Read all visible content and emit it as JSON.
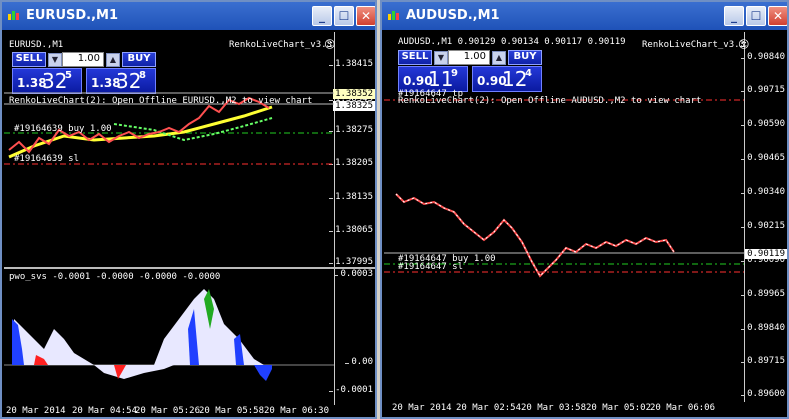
{
  "colors": {
    "titlebar": "#2a5fc8",
    "chart_bg": "#000000",
    "ma_fast": "#ffff33",
    "ma_slow": "#66ff66",
    "tp": "#ff3030",
    "sl": "#ff3030",
    "buyline": "#22cc22"
  },
  "left": {
    "title": "EURUSD.,M1",
    "chart_label": "EURUSD.,M1",
    "indicator_name": "RenkoLiveChart_v3.3",
    "sell_label": "SELL",
    "buy_label": "BUY",
    "lot": "1.00",
    "sell_base": "1.38",
    "sell_big": "32",
    "sell_sup": "5",
    "buy_base": "1.38",
    "buy_big": "32",
    "buy_sup": "8",
    "notice": "RenkoLiveChart(2): Open Offline EURUSD.,M2 to view chart",
    "buy_line": "#19164639 buy 1.00",
    "sl_line": "#19164639 sl",
    "price_ticks": [
      "1.38415",
      "1.38345",
      "1.38275",
      "1.38205",
      "1.38135",
      "1.38065",
      "1.37995"
    ],
    "price_mark_top": "1.38352",
    "price_mark_bottom": "1.38325",
    "osc_label": "pwo_svs -0.0001 -0.0000 -0.0000 -0.0000",
    "osc_ticks": [
      "0.0003",
      "0.00",
      "-0.0001"
    ],
    "time_ticks": [
      "20 Mar 2014",
      "20 Mar 04:54",
      "20 Mar 05:26",
      "20 Mar 05:58",
      "20 Mar 06:30"
    ]
  },
  "right": {
    "title": "AUDUSD.,M1",
    "chart_label": "AUDUSD.,M1  0.90129 0.90134 0.90117 0.90119",
    "indicator_name": "RenkoLiveChart_v3.3",
    "sell_label": "SELL",
    "buy_label": "BUY",
    "lot": "1.00",
    "sell_base": "0.90",
    "sell_big": "11",
    "sell_sup": "9",
    "buy_base": "0.90",
    "buy_big": "12",
    "buy_sup": "4",
    "tp_line": "#19164647 tp",
    "notice": "RenkoLiveChart(2): Open Offline AUDUSD.,M2 to view chart",
    "buy_line": "#19164647 buy 1.00",
    "sl_line": "#19164647 sl",
    "price_ticks": [
      "0.90840",
      "0.90715",
      "0.90590",
      "0.90465",
      "0.90340",
      "0.90215",
      "0.90090",
      "0.89965",
      "0.89840",
      "0.89715",
      "0.89600"
    ],
    "price_mark": "0.90119",
    "time_ticks": [
      "20 Mar 2014",
      "20 Mar 02:54",
      "20 Mar 03:58",
      "20 Mar 05:02",
      "20 Mar 06:06"
    ]
  }
}
